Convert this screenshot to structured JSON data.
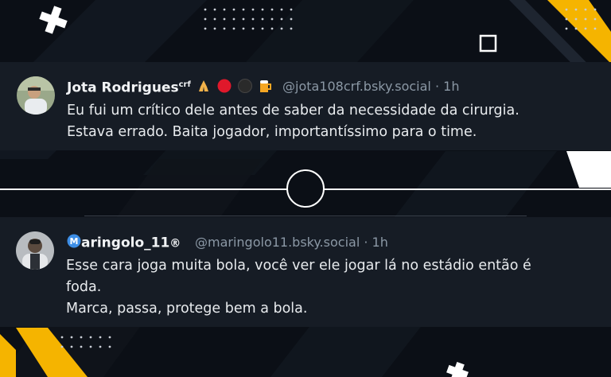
{
  "posts": [
    {
      "display_name": "Jota Rodrigues",
      "name_suffix": "crf",
      "emojis": [
        "praying-hands",
        "red-circle",
        "black-circle",
        "beer-mug"
      ],
      "handle": "@jota108crf.bsky.social",
      "separator": "·",
      "time": "1h",
      "lines": [
        "Eu fui um crítico dele antes de saber da necessidade da cirurgia.",
        "Estava errado. Baita jogador, importantíssimo para o time."
      ]
    },
    {
      "display_name": "aringolo_11",
      "name_prefix_icon": "letter-m-blue-circle",
      "name_suffix": "®",
      "handle": "@maringolo11.bsky.social",
      "separator": "·",
      "time": "1h",
      "lines": [
        "Esse cara joga muita bola, você ver ele jogar lá no estádio então é",
        "foda.",
        "Marca, passa, protege bem a bola."
      ]
    }
  ],
  "colors": {
    "background": "#0b0f16",
    "card": "#161c25",
    "accent_yellow": "#f5b400",
    "handle_gray": "#8b98a5"
  }
}
